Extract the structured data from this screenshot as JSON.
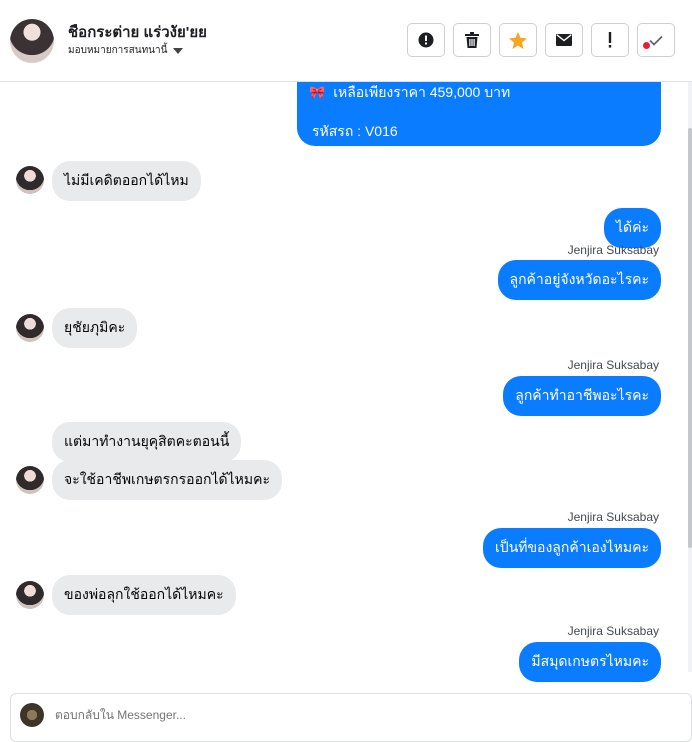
{
  "header": {
    "contact_name": "ชือกระต่าย แร่วงัย'ยย",
    "assign_label": "มอบหมายการสนทนานี้"
  },
  "toolbar": {
    "buttons": [
      "alert-circle-icon",
      "trash-icon",
      "star-icon",
      "envelope-icon",
      "exclamation-icon",
      "check-icon"
    ],
    "star_color": "#f5a623"
  },
  "messages": {
    "product": {
      "price_line": "เหลือเพียงราคา 459,000 บาท",
      "code_line": "รหัสรถ : V016"
    },
    "in_1": "ไม่มีเคดิตออกได้ไหม",
    "out_1": "ได้ค่ะ",
    "sender": "Jenjira Suksabay",
    "out_2": "ลูกค้าอยู่จังหวัดอะไรคะ",
    "in_2": "ยุชัยภุมิคะ",
    "out_3": "ลูกค้าทำอาชีพอะไรคะ",
    "in_3": "แต่มาทำงานยุคุสิตคะตอนนี้",
    "in_4": "จะใช้อาชีพเกษตรกรออกได้ไหมคะ",
    "out_4": "เป็นที่ของลูกค้าเองไหมคะ",
    "in_5": "ของพ่อลุกใช้ออกได้ไหมคะ",
    "out_5": "มีสมุดเกษตรไหมคะ"
  },
  "composer": {
    "placeholder": "ตอบกลับใน Messenger..."
  },
  "colors": {
    "outgoing_bubble": "#0a7cff",
    "incoming_bubble": "#e9eaec"
  }
}
